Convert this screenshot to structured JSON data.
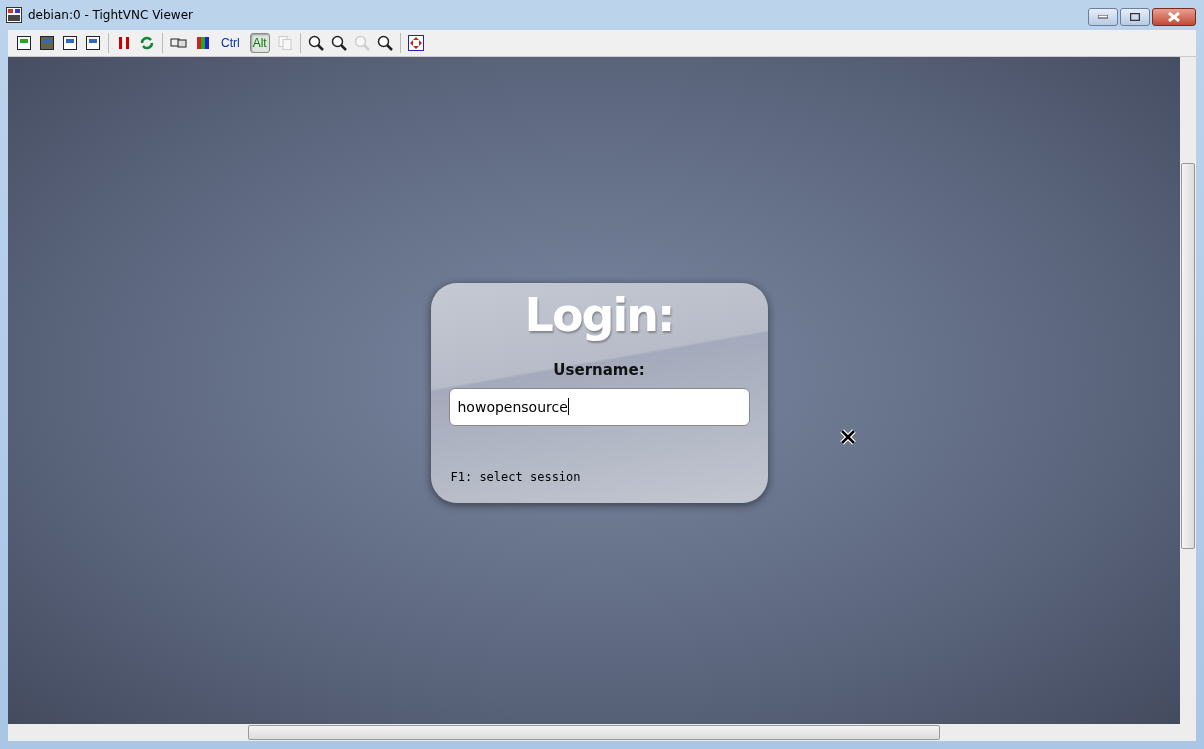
{
  "window": {
    "title": "debian:0 - TightVNC Viewer"
  },
  "toolbar": {
    "keys": [
      {
        "label": "Ctrl",
        "on": false
      },
      {
        "label": "Alt",
        "on": true
      }
    ]
  },
  "login": {
    "title": "Login:",
    "username_label": "Username:",
    "username_value": "howopensource",
    "hint": "F1: select session"
  }
}
